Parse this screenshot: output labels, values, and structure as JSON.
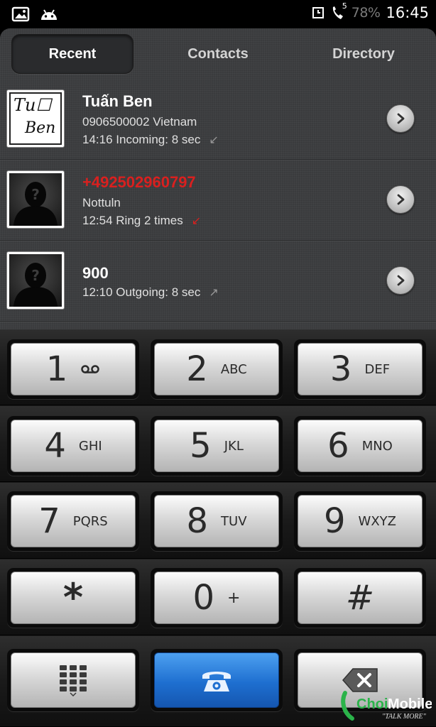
{
  "status_bar": {
    "battery": "78%",
    "time": "16:45",
    "call_badge": "5",
    "icons": [
      "gallery-icon",
      "android-icon",
      "alarm-icon",
      "call-forward-icon"
    ]
  },
  "tabs": [
    {
      "label": "Recent",
      "active": true
    },
    {
      "label": "Contacts",
      "active": false
    },
    {
      "label": "Directory",
      "active": false
    }
  ],
  "calls": [
    {
      "name": "Tuấn Ben",
      "line2": "0906500002  Vietnam",
      "line3": "14:16 Incoming: 8 sec",
      "direction": "incoming",
      "missed": false,
      "avatar_text": [
        "Tu☐",
        "Ben"
      ]
    },
    {
      "name": "+492502960797",
      "line2": "Nottuln",
      "line3": "12:54 Ring 2 times",
      "direction": "missed",
      "missed": true
    },
    {
      "name": "900",
      "line3": "12:10 Outgoing: 8 sec",
      "direction": "outgoing",
      "missed": false
    }
  ],
  "keypad": [
    [
      {
        "digit": "1",
        "letters": "",
        "icon": "voicemail-icon"
      },
      {
        "digit": "2",
        "letters": "ABC"
      },
      {
        "digit": "3",
        "letters": "DEF"
      }
    ],
    [
      {
        "digit": "4",
        "letters": "GHI"
      },
      {
        "digit": "5",
        "letters": "JKL"
      },
      {
        "digit": "6",
        "letters": "MNO"
      }
    ],
    [
      {
        "digit": "7",
        "letters": "PQRS"
      },
      {
        "digit": "8",
        "letters": "TUV"
      },
      {
        "digit": "9",
        "letters": "WXYZ"
      }
    ],
    [
      {
        "digit": "*",
        "letters": ""
      },
      {
        "digit": "0",
        "letters": "+"
      },
      {
        "digit": "#",
        "letters": ""
      }
    ]
  ],
  "actions": {
    "left_icon": "dialpad-toggle-icon",
    "center_icon": "phone-icon",
    "right_icon": "backspace-icon"
  },
  "watermark": {
    "brand": "ChoiMobile",
    "tagline": "TALK MORE"
  },
  "colors": {
    "missed": "#d9201f",
    "call_button": "#1e6fd0"
  }
}
